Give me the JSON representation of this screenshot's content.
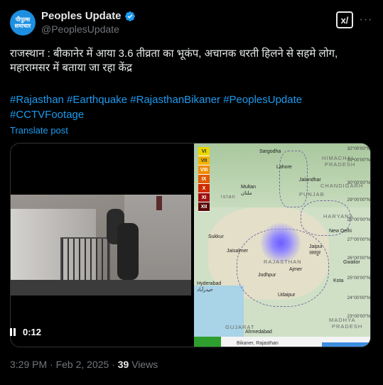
{
  "account": {
    "avatar_text_line1": "पीपुल्स",
    "avatar_text_line2": "समाचार",
    "display_name": "Peoples Update",
    "handle": "@PeoplesUpdate"
  },
  "header": {
    "grok_icon": "grok-icon",
    "more_icon": "more-icon",
    "more_label": "···"
  },
  "tweet": {
    "text": "राजस्थान : बीकानेर में आया 3.6 तीव्रता का भूकंप, अचानक धरती हिलने से सहमे लोग, महारामसर में बताया जा रहा केंद्र",
    "hashtags_line1": "#Rajasthan #Earthquake #RajasthanBikaner #PeoplesUpdate",
    "hashtags_line2": "#CCTVFootage",
    "translate_label": "Translate post"
  },
  "video": {
    "time": "0:12"
  },
  "map": {
    "scale": [
      "VI",
      "VII",
      "VIII",
      "IX",
      "X",
      "XI",
      "XII"
    ],
    "scale_colors": [
      "#e8d800",
      "#f0b400",
      "#f08c00",
      "#e05a00",
      "#d02a00",
      "#a01010",
      "#5a0808"
    ],
    "labels": {
      "sargodha": "Sargodha",
      "himachal": "HIMACHAL",
      "pradesh": "PRADESH",
      "lahore": "Lahore",
      "jalandhar": "Jalandhar",
      "chandigarh": "CHANDIGARH",
      "punjab": "PUNJAB",
      "multan": "Multan",
      "multan_urdu": "ملتان",
      "haryana": "HARYANA",
      "pakistan": "istan",
      "new_delhi": "New Delhi",
      "jaipur": "Jaipur",
      "jaipur_hindi": "जयपुर",
      "rajasthan": "RAJASTHAN",
      "sukkur": "Sukkur",
      "jaisalmer": "Jaisalmer",
      "hyderabad": "Hyderabad",
      "hyderabad_urdu": "حیدرآباد",
      "gujarat": "GUJARAT",
      "ahmedabad": "Ahmedabad",
      "madhya": "MADHYA",
      "pradesh2": "PRADESH",
      "bikaner": "Bikaner, Rajasthan",
      "ajmer": "Ajmer",
      "udaipur": "Udaipur",
      "kota": "Kota",
      "gwalior": "Gwalior",
      "jodhpur": "Jodhpur"
    },
    "coords": [
      "32°00'00\"N",
      "31°00'00\"N",
      "30°00'00\"N",
      "29°00'00\"N",
      "28°00'00\"N",
      "27°00'00\"N",
      "26°00'00\"N",
      "25°00'00\"N",
      "24°00'00\"N",
      "23°00'00\"N"
    ]
  },
  "meta": {
    "time": "3:29 PM · Feb 2, 2025 ·",
    "views_count": "39",
    "views_label": "Views"
  }
}
